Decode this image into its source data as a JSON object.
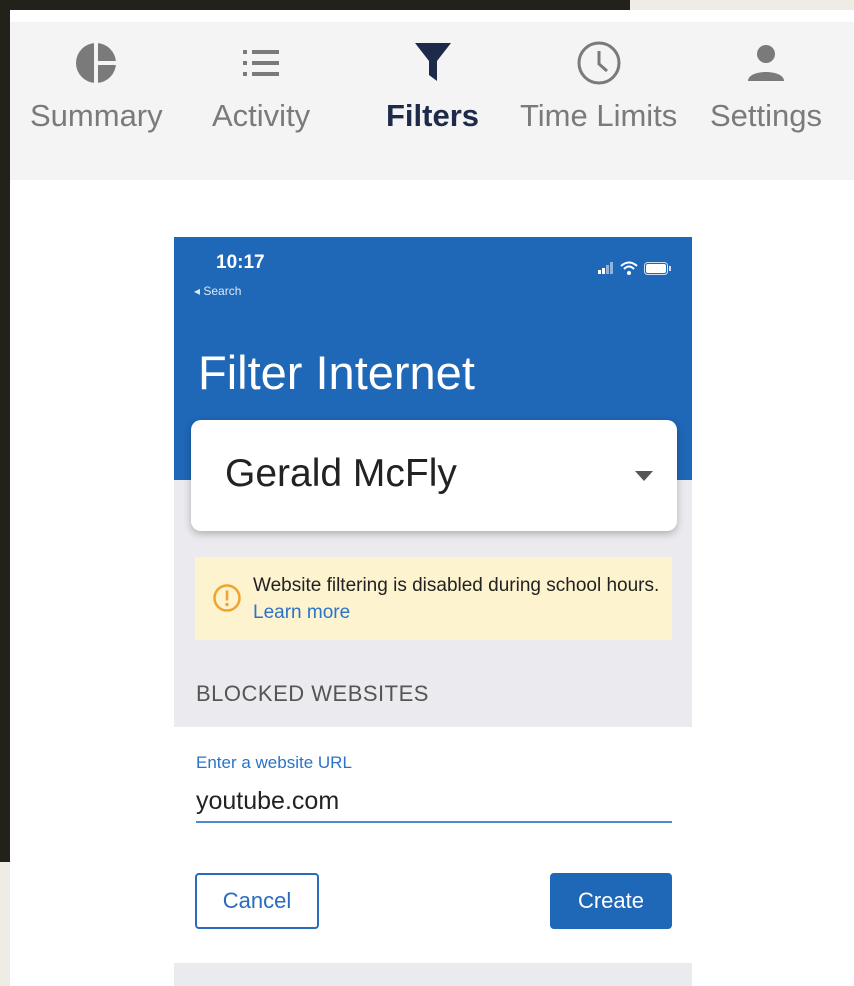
{
  "tabs": [
    {
      "label": "Summary",
      "icon": "pie-chart-icon",
      "active": false
    },
    {
      "label": "Activity",
      "icon": "list-icon",
      "active": false
    },
    {
      "label": "Filters",
      "icon": "filter-icon",
      "active": true
    },
    {
      "label": "Time Limits",
      "icon": "clock-icon",
      "active": false
    },
    {
      "label": "Settings",
      "icon": "person-icon",
      "active": false
    }
  ],
  "phone": {
    "status": {
      "time": "10:17",
      "back_label": "◂ Search"
    },
    "title": "Filter Internet",
    "member_select": {
      "value": "Gerald McFly"
    },
    "notice": {
      "text": "Website filtering is disabled during school hours.",
      "link": "Learn more"
    },
    "section_header": "BLOCKED WEBSITES",
    "url_field": {
      "label": "Enter a website URL",
      "value": "youtube.com"
    },
    "cancel_label": "Cancel",
    "create_label": "Create"
  },
  "colors": {
    "brand_blue": "#1f67b7",
    "notice_bg": "#fdf3cf",
    "notice_icon": "#f0a42b",
    "link_blue": "#2a73c7"
  }
}
